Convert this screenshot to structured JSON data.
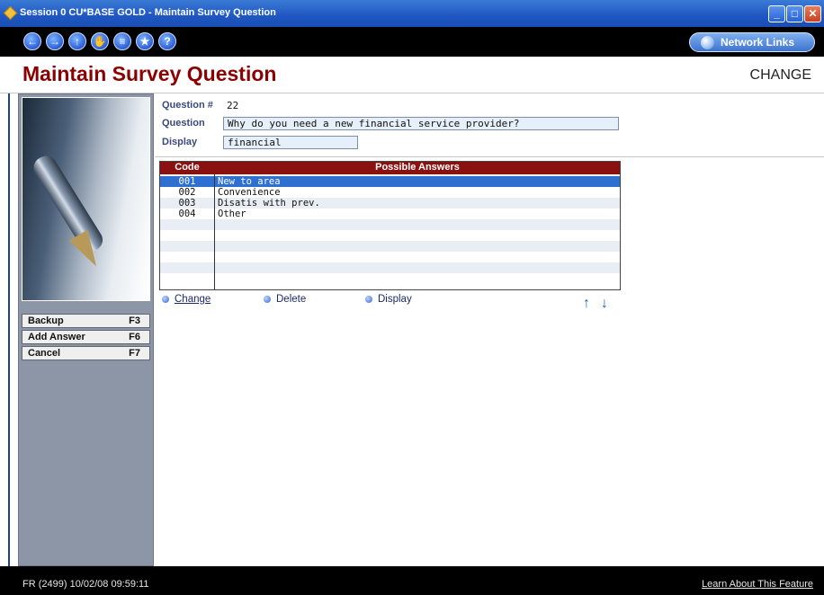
{
  "window": {
    "title": "Session 0 CU*BASE GOLD - Maintain Survey Question"
  },
  "toolbar": {
    "nav_icons": [
      "back-icon",
      "forward-icon",
      "up-icon",
      "hand-icon",
      "print-icon",
      "star-icon",
      "help-icon"
    ],
    "network_links_label": "Network Links"
  },
  "header": {
    "title": "Maintain Survey Question",
    "mode": "CHANGE"
  },
  "form": {
    "question_no_label": "Question #",
    "question_no_value": "22",
    "question_label": "Question",
    "question_value": "Why do you need a new financial service provider?",
    "display_label": "Display",
    "display_value": "financial"
  },
  "grid": {
    "headers": {
      "code": "Code",
      "answers": "Possible Answers"
    },
    "rows": [
      {
        "code": "001",
        "answer": "New to area"
      },
      {
        "code": "002",
        "answer": "Convenience"
      },
      {
        "code": "003",
        "answer": "Disatis with prev."
      },
      {
        "code": "004",
        "answer": "Other"
      }
    ]
  },
  "actions": {
    "change": "Change",
    "delete": "Delete",
    "display": "Display"
  },
  "function_keys": [
    {
      "label": "Backup",
      "key": "F3"
    },
    {
      "label": "Add Answer",
      "key": "F6"
    },
    {
      "label": "Cancel",
      "key": "F7"
    }
  ],
  "status": {
    "left": "FR (2499) 10/02/08 09:59:11",
    "right": "Learn About This Feature"
  },
  "colors": {
    "title_red": "#8b0000",
    "header_red": "#8b1010",
    "selection_blue": "#2e6fcf"
  }
}
